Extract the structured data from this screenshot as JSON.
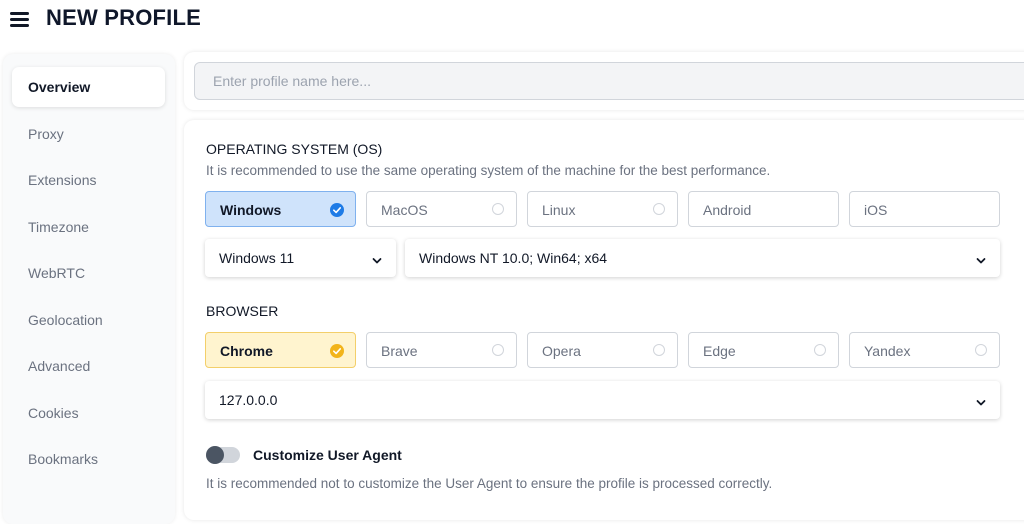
{
  "header": {
    "title": "NEW PROFILE"
  },
  "sidebar": {
    "items": [
      {
        "label": "Overview"
      },
      {
        "label": "Proxy"
      },
      {
        "label": "Extensions"
      },
      {
        "label": "Timezone"
      },
      {
        "label": "WebRTC"
      },
      {
        "label": "Geolocation"
      },
      {
        "label": "Advanced"
      },
      {
        "label": "Cookies"
      },
      {
        "label": "Bookmarks"
      }
    ]
  },
  "profile": {
    "name_placeholder": "Enter profile name here..."
  },
  "os": {
    "title": "OPERATING SYSTEM (OS)",
    "description": "It is recommended to use the same operating system of the machine for the best performance.",
    "options": [
      {
        "label": "Windows"
      },
      {
        "label": "MacOS"
      },
      {
        "label": "Linux"
      },
      {
        "label": "Android"
      },
      {
        "label": "iOS"
      }
    ],
    "version": "Windows 11",
    "platform": "Windows NT 10.0; Win64; x64"
  },
  "browser": {
    "title": "BROWSER",
    "options": [
      {
        "label": "Chrome"
      },
      {
        "label": "Brave"
      },
      {
        "label": "Opera"
      },
      {
        "label": "Edge"
      },
      {
        "label": "Yandex"
      }
    ],
    "version": "127.0.0.0"
  },
  "user_agent": {
    "toggle_label": "Customize User Agent",
    "description": "It is recommended not to customize the User Agent to ensure the profile is processed correctly."
  },
  "colors": {
    "os_selected_fill": "#cfe3fb",
    "os_check": "#1e7be6",
    "browser_selected_fill": "#fff4cf",
    "browser_check": "#f2b41b"
  }
}
